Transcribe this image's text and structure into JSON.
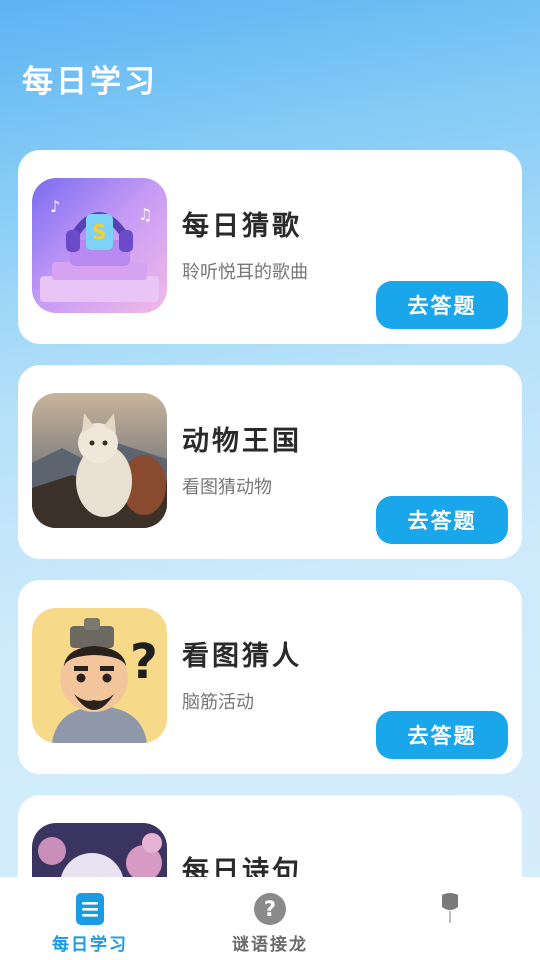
{
  "page": {
    "title": "每日学习"
  },
  "cards": [
    {
      "title": "每日猜歌",
      "subtitle": "聆听悦耳的歌曲",
      "button": "去答题",
      "image": "music-headphones-image"
    },
    {
      "title": "动物王国",
      "subtitle": "看图猜动物",
      "button": "去答题",
      "image": "cat-image"
    },
    {
      "title": "看图猜人",
      "subtitle": "脑筋活动",
      "button": "去答题",
      "image": "cartoon-person-image"
    },
    {
      "title": "每日诗句",
      "image": "moon-blossom-image"
    }
  ],
  "tabbar": {
    "tabs": [
      {
        "label": "每日学习",
        "icon": "list-icon",
        "active": true
      },
      {
        "label": "谜语接龙",
        "icon": "question-icon",
        "active": false
      },
      {
        "label": "",
        "icon": "tab3-icon",
        "active": false
      }
    ]
  },
  "colors": {
    "accent": "#1aa6ea",
    "active_tab": "#1a9be4",
    "inactive_tab": "#6b6b6b",
    "card_bg": "#ffffff"
  }
}
